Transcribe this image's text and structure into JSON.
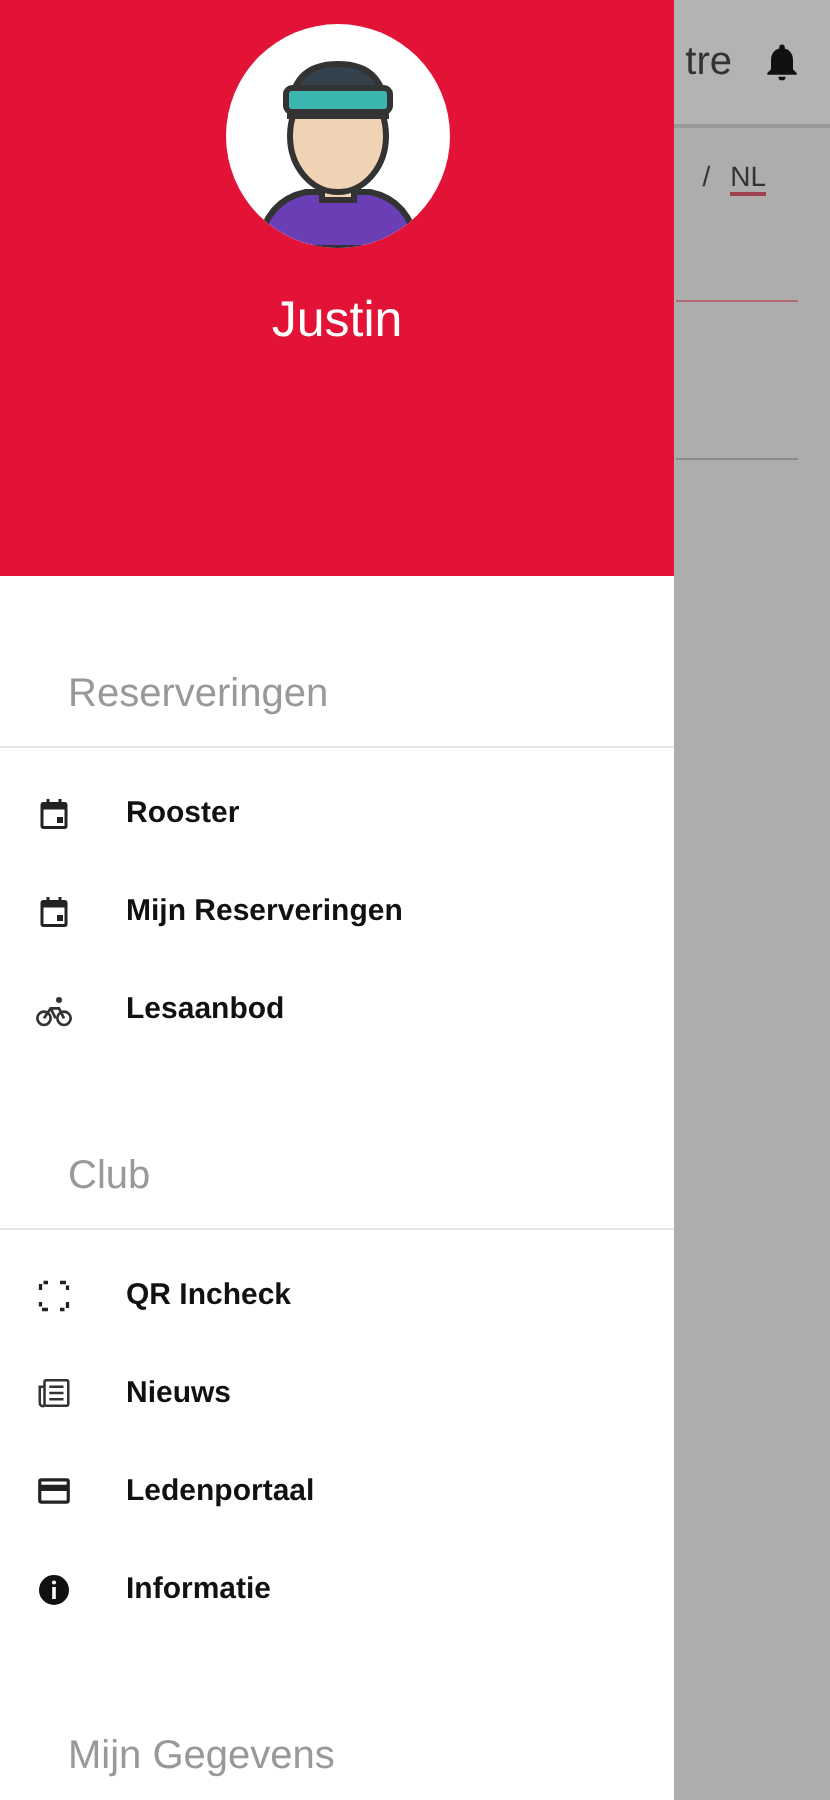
{
  "background_page": {
    "title": "tre",
    "language": {
      "separator": "/",
      "current": "NL"
    }
  },
  "drawer": {
    "user_name": "Justin",
    "sections": [
      {
        "title": "Reserveringen",
        "items": [
          {
            "label": "Rooster",
            "kind": "calendar"
          },
          {
            "label": "Mijn Reserveringen",
            "kind": "calendar"
          },
          {
            "label": "Lesaanbod",
            "kind": "bike"
          }
        ]
      },
      {
        "title": "Club",
        "items": [
          {
            "label": "QR Incheck",
            "kind": "scan"
          },
          {
            "label": "Nieuws",
            "kind": "news"
          },
          {
            "label": "Ledenportaal",
            "kind": "card"
          },
          {
            "label": "Informatie",
            "kind": "info"
          }
        ]
      },
      {
        "title": "Mijn Gegevens"
      }
    ]
  }
}
